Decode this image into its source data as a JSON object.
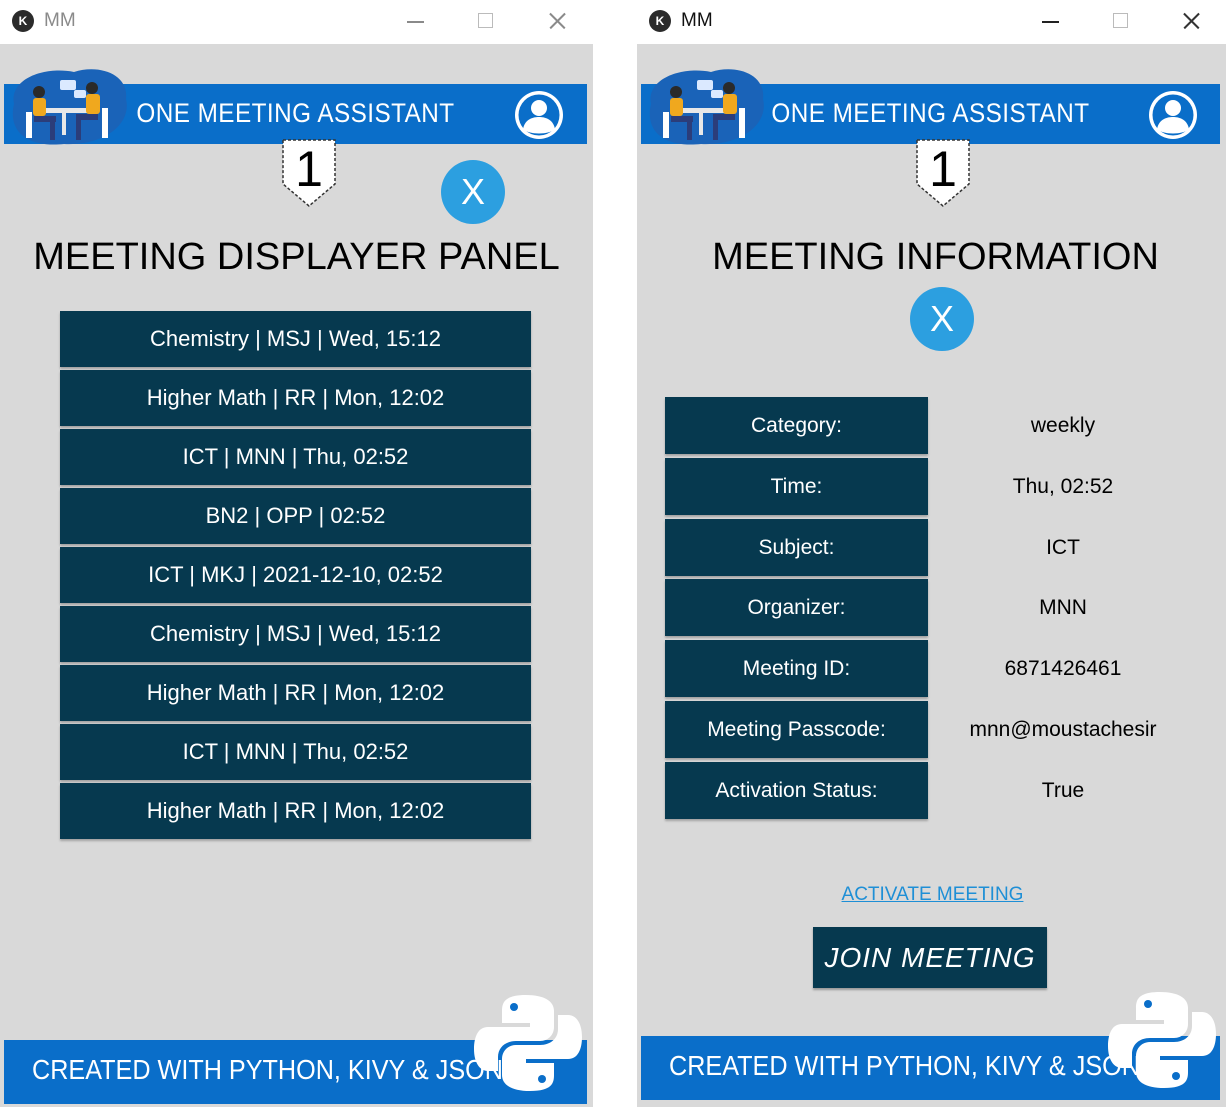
{
  "left_window": {
    "title": "MM",
    "header_title": "ONE MEETING ASSISTANT",
    "badge_number": "1",
    "close_label": "X",
    "panel_title": "MEETING DISPLAYER PANEL",
    "meetings": [
      "Chemistry | MSJ | Wed, 15:12",
      "Higher Math | RR | Mon, 12:02",
      "ICT | MNN | Thu, 02:52",
      "BN2 | OPP | 02:52",
      "ICT | MKJ | 2021-12-10, 02:52",
      "Chemistry | MSJ | Wed, 15:12",
      "Higher Math | RR | Mon, 12:02",
      "ICT | MNN | Thu, 02:52",
      "Higher Math | RR | Mon, 12:02"
    ],
    "footer_text": "CREATED WITH PYTHON, KIVY & JSON"
  },
  "right_window": {
    "title": "MM",
    "header_title": "ONE MEETING ASSISTANT",
    "badge_number": "1",
    "close_label": "X",
    "panel_title": "MEETING INFORMATION",
    "info": [
      {
        "label": "Category:",
        "value": "weekly"
      },
      {
        "label": "Time:",
        "value": "Thu, 02:52"
      },
      {
        "label": "Subject:",
        "value": "ICT"
      },
      {
        "label": "Organizer:",
        "value": "MNN"
      },
      {
        "label": "Meeting ID:",
        "value": "6871426461"
      },
      {
        "label": "Meeting Passcode:",
        "value": "mnn@moustachesir"
      },
      {
        "label": "Activation Status:",
        "value": "True"
      }
    ],
    "activate_link": "ACTIVATE MEETING",
    "join_button": "JOIN MEETING",
    "footer_text": "CREATED WITH PYTHON, KIVY & JSON"
  },
  "colors": {
    "header_blue": "#0a6ec9",
    "dark_teal": "#06394f",
    "close_blue": "#2c9fe0",
    "background": "#d9d9d9"
  }
}
